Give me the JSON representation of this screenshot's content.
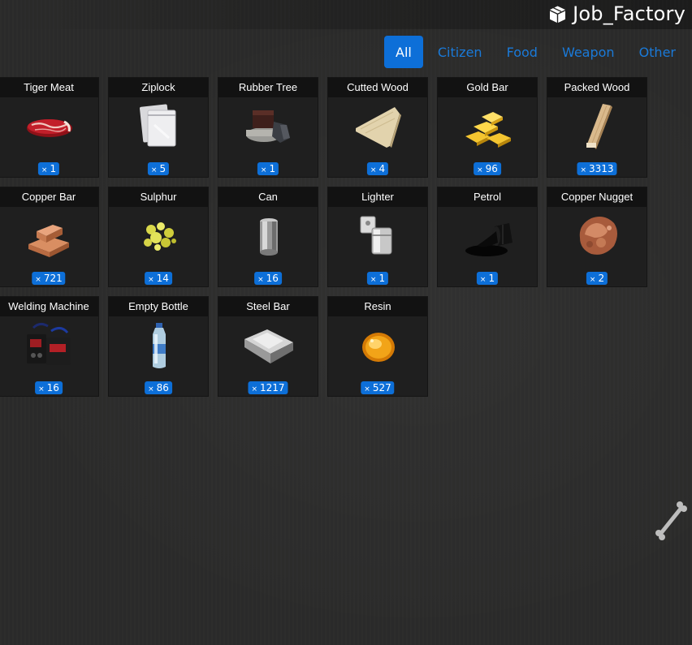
{
  "header": {
    "title": "Job_Factory",
    "icon": "box-icon"
  },
  "tabs": [
    {
      "label": "All",
      "active": true
    },
    {
      "label": "Citizen",
      "active": false
    },
    {
      "label": "Food",
      "active": false
    },
    {
      "label": "Weapon",
      "active": false
    },
    {
      "label": "Other",
      "active": false
    }
  ],
  "qty_prefix": "×",
  "items": [
    {
      "name": "Tiger Meat",
      "qty": "1",
      "icon": "meat-icon"
    },
    {
      "name": "Ziplock",
      "qty": "5",
      "icon": "ziplock-icon"
    },
    {
      "name": "Rubber Tree",
      "qty": "1",
      "icon": "rubber-tree-icon"
    },
    {
      "name": "Cutted Wood",
      "qty": "4",
      "icon": "cutted-wood-icon"
    },
    {
      "name": "Gold Bar",
      "qty": "96",
      "icon": "gold-bar-icon"
    },
    {
      "name": "Packed Wood",
      "qty": "3313",
      "icon": "packed-wood-icon"
    },
    {
      "name": "Copper Bar",
      "qty": "721",
      "icon": "copper-bar-icon"
    },
    {
      "name": "Sulphur",
      "qty": "14",
      "icon": "sulphur-icon"
    },
    {
      "name": "Can",
      "qty": "16",
      "icon": "can-icon"
    },
    {
      "name": "Lighter",
      "qty": "1",
      "icon": "lighter-icon"
    },
    {
      "name": "Petrol",
      "qty": "1",
      "icon": "petrol-icon"
    },
    {
      "name": "Copper Nugget",
      "qty": "2",
      "icon": "copper-nugget-icon"
    },
    {
      "name": "Welding Machine",
      "qty": "16",
      "icon": "welding-machine-icon"
    },
    {
      "name": "Empty Bottle",
      "qty": "86",
      "icon": "bottle-icon"
    },
    {
      "name": "Steel Bar",
      "qty": "1217",
      "icon": "steel-bar-icon"
    },
    {
      "name": "Resin",
      "qty": "527",
      "icon": "resin-icon"
    }
  ],
  "colors": {
    "accent": "#0d6fd8",
    "tab_text": "#1a7ad9",
    "card_bg": "#1f1f1f",
    "card_header": "#121212",
    "background": "#2b2b2a"
  }
}
